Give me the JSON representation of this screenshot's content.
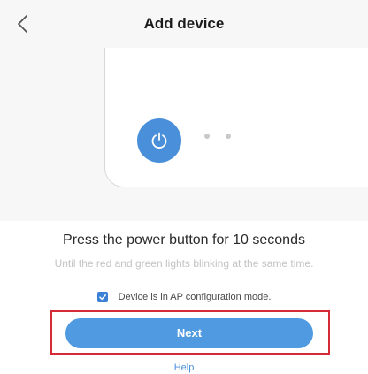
{
  "header": {
    "title": "Add device",
    "back_icon": "chevron-left-icon"
  },
  "illustration": {
    "power_icon": "power-icon",
    "power_color": "#4a8fd9"
  },
  "instructions": {
    "title": "Press the power button for 10 seconds",
    "subtitle": "Until the red and green lights blinking at the same time."
  },
  "confirm": {
    "checked": true,
    "label": "Device is in AP configuration mode."
  },
  "actions": {
    "next_label": "Next",
    "help_label": "Help",
    "highlight_color": "#d62b36",
    "accent_color": "#4f9ae0"
  }
}
